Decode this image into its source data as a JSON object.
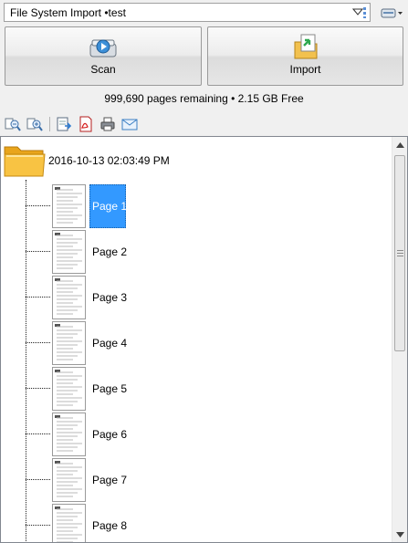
{
  "profile": {
    "name": "File System Import •test"
  },
  "buttons": {
    "scan_label": "Scan",
    "import_label": "Import"
  },
  "status": {
    "text": "999,690 pages remaining  •  2.15 GB Free"
  },
  "toolbar": {
    "icons": [
      "zoom-out-icon",
      "zoom-in-icon",
      "export-icon",
      "pdf-icon",
      "print-icon",
      "email-icon"
    ]
  },
  "tree": {
    "batch_label": "2016-10-13 02:03:49 PM",
    "pages": [
      {
        "label": "Page 1",
        "selected": true
      },
      {
        "label": "Page 2",
        "selected": false
      },
      {
        "label": "Page 3",
        "selected": false
      },
      {
        "label": "Page 4",
        "selected": false
      },
      {
        "label": "Page 5",
        "selected": false
      },
      {
        "label": "Page 6",
        "selected": false
      },
      {
        "label": "Page 7",
        "selected": false
      },
      {
        "label": "Page 8",
        "selected": false
      }
    ]
  },
  "colors": {
    "selection": "#3399ff",
    "folder": "#f5b82a"
  }
}
